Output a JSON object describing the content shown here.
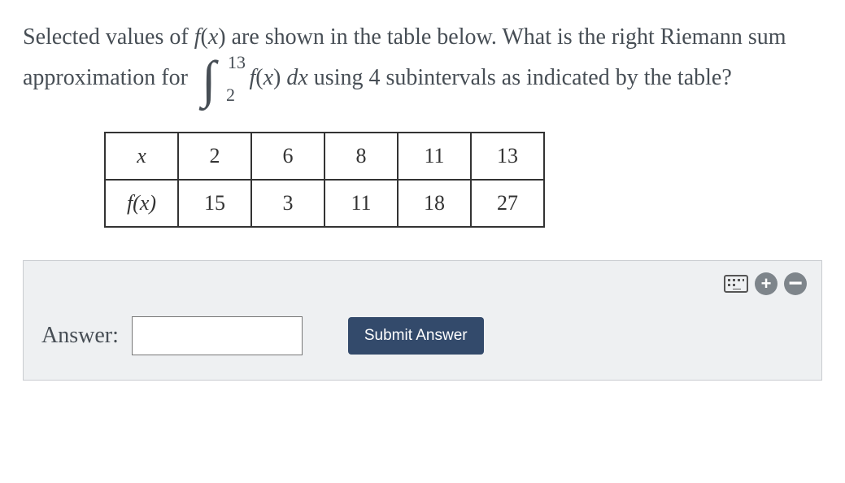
{
  "question": {
    "part1": "Selected values of ",
    "fn": "f",
    "var": "x",
    "part2": " are shown in the table below. What is the right Riemann sum approximation for ",
    "integral_lower": "2",
    "integral_upper": "13",
    "integrand_fn": "f",
    "integrand_var": "x",
    "dvar": "dx",
    "part3": " using 4 subintervals as indicated by the table?"
  },
  "table": {
    "row_x_label": "x",
    "row_f_label": "f(x)",
    "x_values": [
      "2",
      "6",
      "8",
      "11",
      "13"
    ],
    "f_values": [
      "15",
      "3",
      "11",
      "18",
      "27"
    ]
  },
  "answer_panel": {
    "label": "Answer:",
    "input_value": "",
    "submit_label": "Submit Answer"
  },
  "icons": {
    "keyboard": "keyboard-icon",
    "plus": "+",
    "minus": "−"
  },
  "chart_data": {
    "type": "table",
    "title": "Selected values of f(x)",
    "columns": [
      "x",
      "f(x)"
    ],
    "rows": [
      {
        "x": 2,
        "f": 15
      },
      {
        "x": 6,
        "f": 3
      },
      {
        "x": 8,
        "f": 11
      },
      {
        "x": 11,
        "f": 18
      },
      {
        "x": 13,
        "f": 27
      }
    ],
    "integral": {
      "lower": 2,
      "upper": 13,
      "method": "right-riemann",
      "subintervals": 4
    }
  }
}
